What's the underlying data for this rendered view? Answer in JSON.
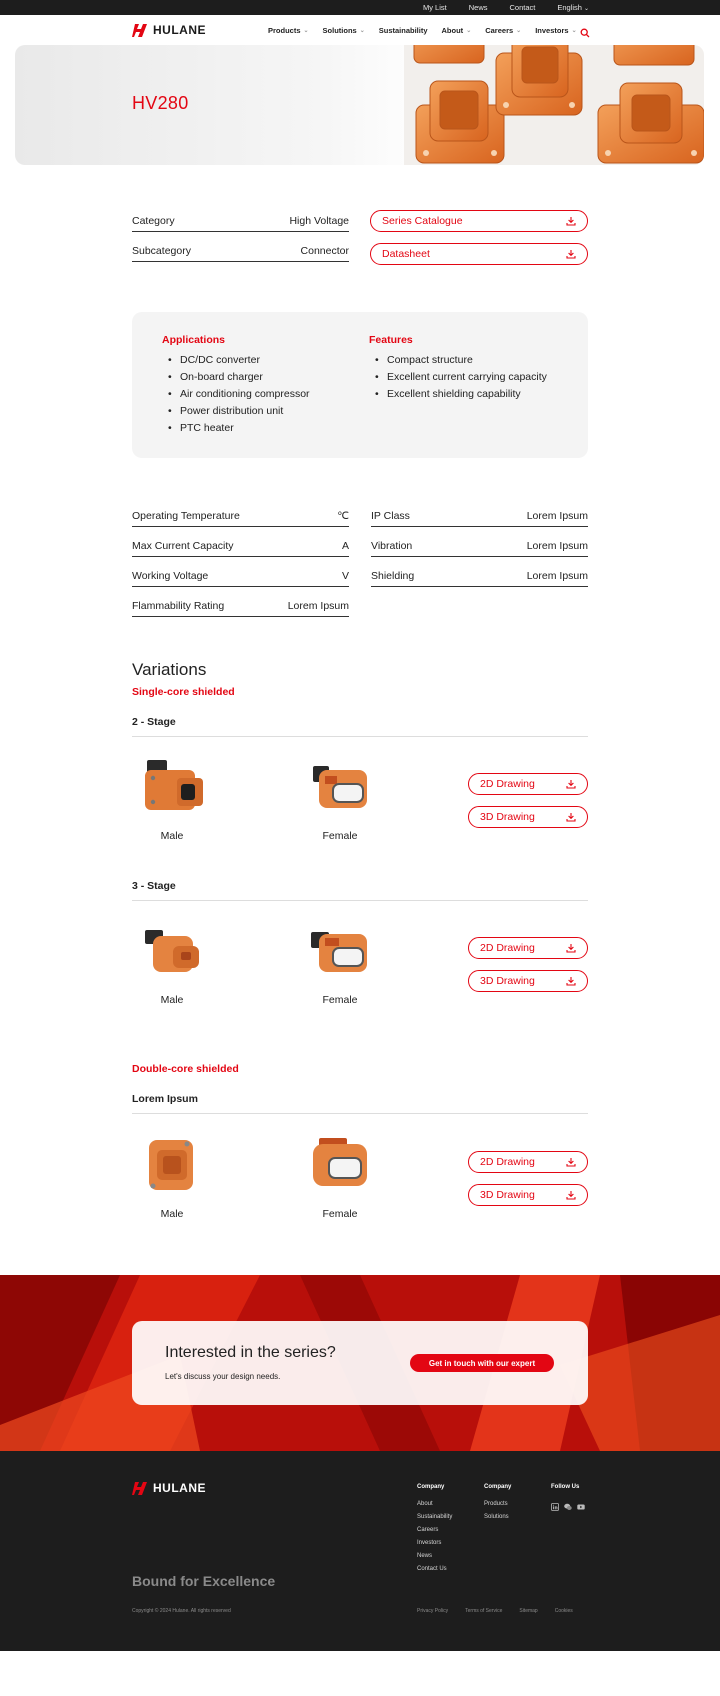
{
  "colors": {
    "accent": "#e30613",
    "dark": "#1d1d1d",
    "panel": "#f4f4f4"
  },
  "topbar": {
    "links": [
      "My List",
      "News",
      "Contact"
    ],
    "language": "English"
  },
  "nav": {
    "logo": "HULANE",
    "items": [
      {
        "label": "Products",
        "dropdown": true
      },
      {
        "label": "Solutions",
        "dropdown": true
      },
      {
        "label": "Sustainability",
        "dropdown": false
      },
      {
        "label": "About",
        "dropdown": true
      },
      {
        "label": "Careers",
        "dropdown": true
      },
      {
        "label": "Investors",
        "dropdown": true
      }
    ]
  },
  "hero": {
    "title": "HV280"
  },
  "overview": {
    "category_label": "Category",
    "category_value": "High Voltage",
    "subcategory_label": "Subcategory",
    "subcategory_value": "Connector",
    "catalogue_label": "Series Catalogue",
    "datasheet_label": "Datasheet"
  },
  "applications": {
    "title": "Applications",
    "items": [
      "DC/DC converter",
      "On-board charger",
      "Air conditioning compressor",
      "Power distribution unit",
      "PTC heater"
    ]
  },
  "features": {
    "title": "Features",
    "items": [
      "Compact structure",
      "Excellent current carrying capacity",
      "Excellent shielding capability"
    ]
  },
  "specs": [
    {
      "label": "Operating Temperature",
      "value": "℃"
    },
    {
      "label": "Max Current Capacity",
      "value": "A"
    },
    {
      "label": "Working Voltage",
      "value": "V"
    },
    {
      "label": "Flammability Rating",
      "value": "Lorem Ipsum"
    },
    {
      "label": "IP Class",
      "value": "Lorem Ipsum"
    },
    {
      "label": "Vibration",
      "value": "Lorem Ipsum"
    },
    {
      "label": "Shielding",
      "value": "Lorem Ipsum"
    }
  ],
  "variations": {
    "title": "Variations",
    "groups": [
      {
        "name": "Single-core shielded",
        "stages": [
          {
            "name": "2 - Stage",
            "male": "Male",
            "female": "Female",
            "d2": "2D Drawing",
            "d3": "3D Drawing"
          },
          {
            "name": "3 - Stage",
            "male": "Male",
            "female": "Female",
            "d2": "2D Drawing",
            "d3": "3D Drawing"
          }
        ]
      },
      {
        "name": "Double-core shielded",
        "stages": [
          {
            "name": "Lorem Ipsum",
            "male": "Male",
            "female": "Female",
            "d2": "2D Drawing",
            "d3": "3D Drawing"
          }
        ]
      }
    ]
  },
  "cta": {
    "heading": "Interested in the series?",
    "text": "Let's discuss your design needs.",
    "button": "Get in touch with our expert"
  },
  "footer": {
    "logo": "HULANE",
    "col1": {
      "title": "Company",
      "links": [
        "About",
        "Sustainability",
        "Careers",
        "Investors",
        "News",
        "Contact Us"
      ]
    },
    "col2": {
      "title": "Company",
      "links": [
        "Products",
        "Solutions"
      ]
    },
    "col3": {
      "title": "Follow Us",
      "icons": [
        "linkedin-icon",
        "wechat-icon",
        "youtube-icon"
      ]
    },
    "tagline": "Bound for Excellence",
    "copyright": "Copyright © 2024 Hulane. All rights reserved",
    "legal": [
      "Privacy Policy",
      "Terms of Service",
      "Sitemap",
      "Cookies"
    ]
  }
}
